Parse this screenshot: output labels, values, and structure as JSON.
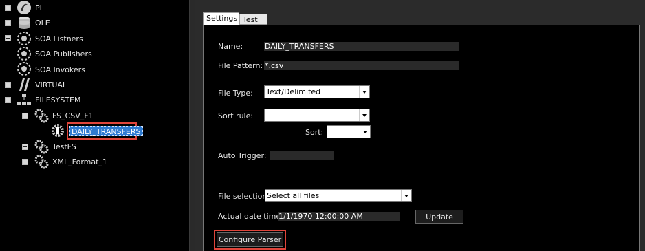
{
  "tree": {
    "items": [
      {
        "label": "PI",
        "icon": "pi-icon",
        "expander": "plus"
      },
      {
        "label": "OLE",
        "icon": "database-icon",
        "expander": "plus"
      },
      {
        "label": "SOA Listners",
        "icon": "soa-listener-icon",
        "expander": "plus"
      },
      {
        "label": "SOA Publishers",
        "icon": "soa-publisher-icon",
        "expander": "none"
      },
      {
        "label": "SOA Invokers",
        "icon": "soa-invoker-icon",
        "expander": "none"
      },
      {
        "label": "VIRTUAL",
        "icon": "virtual-icon",
        "expander": "plus"
      },
      {
        "label": "FILESYSTEM",
        "icon": "filesystem-icon",
        "expander": "minus"
      },
      {
        "label": "FS_CSV_F1",
        "icon": "gear-icon",
        "expander": "minus"
      },
      {
        "label": "DAILY_TRANSFERS",
        "icon": "parser-gear-icon",
        "expander": "none",
        "selected": true
      },
      {
        "label": "TestFS",
        "icon": "gear-icon",
        "expander": "plus"
      },
      {
        "label": "XML_Format_1",
        "icon": "gear-icon",
        "expander": "plus"
      }
    ]
  },
  "tabs": {
    "settings": "Settings",
    "test": "Test"
  },
  "form": {
    "name_label": "Name:",
    "name_value": "DAILY_TRANSFERS",
    "pattern_label": "File Pattern:",
    "pattern_value": "*.csv",
    "type_label": "File Type:",
    "type_value": "Text/Delimited",
    "sort_rule_label": "Sort rule:",
    "sort_rule_value": "",
    "sort_label": "Sort:",
    "sort_value": "",
    "auto_trigger_label": "Auto Trigger:",
    "auto_trigger_value": "",
    "file_selection_label": "File selection:",
    "file_selection_value": "Select all files",
    "actual_date_label": "Actual date  time:",
    "actual_date_value": "1/1/1970 12:00:00 AM",
    "update_button": "Update",
    "configure_button": "Configure Parser"
  },
  "colors": {
    "highlight": "#e0453b",
    "selection": "#2f7bd1"
  }
}
